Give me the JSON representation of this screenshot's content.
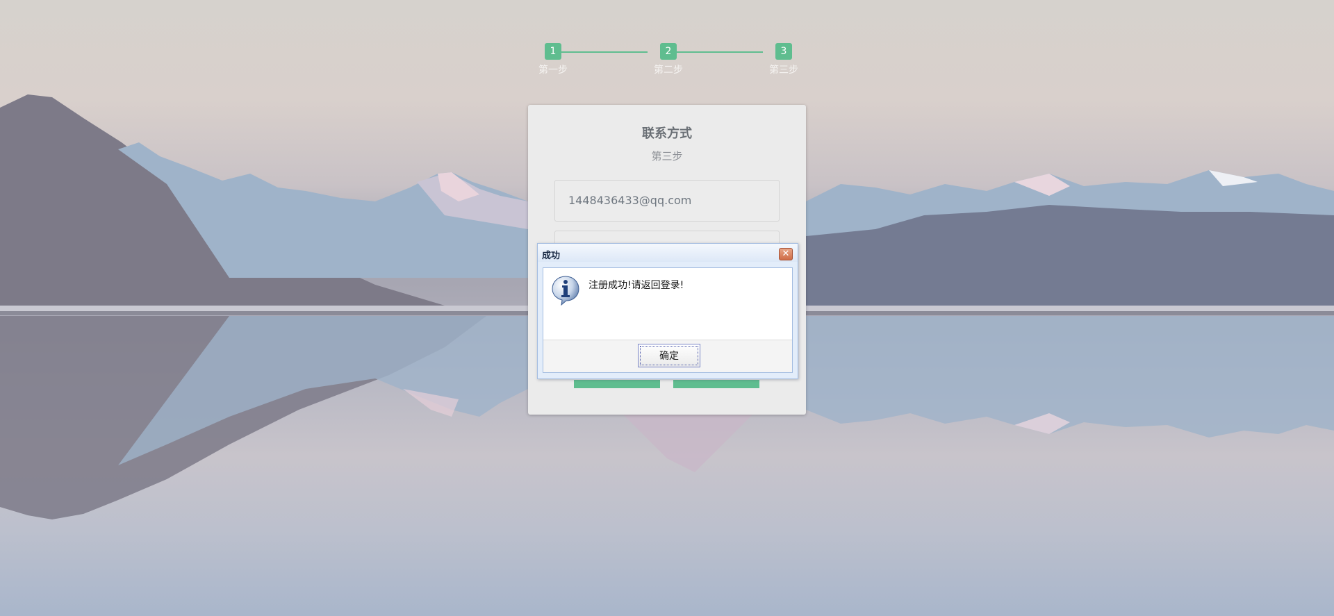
{
  "stepper": {
    "steps": [
      {
        "number": "1",
        "label": "第一步"
      },
      {
        "number": "2",
        "label": "第二步"
      },
      {
        "number": "3",
        "label": "第三步"
      }
    ],
    "accent_color": "#5fbd8f"
  },
  "form": {
    "title": "联系方式",
    "subtitle": "第三步",
    "email_value": "1448436433@qq.com"
  },
  "dialog": {
    "title": "成功",
    "close_symbol": "✕",
    "icon": "info-icon",
    "message": "注册成功!请返回登录!",
    "ok_label": "确定"
  }
}
